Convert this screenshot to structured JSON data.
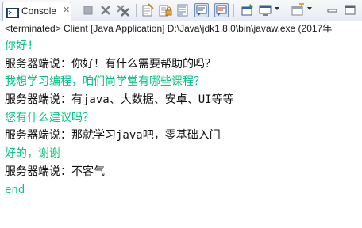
{
  "tab": {
    "label": "Console",
    "close": "✕"
  },
  "toolbar_icons": [
    "terminate-icon",
    "remove-launch-icon",
    "remove-all-icon",
    "clear-console-icon",
    "scroll-lock-icon",
    "word-wrap-icon",
    "show-on-stdout-icon",
    "show-on-stderr-icon",
    "pin-console-icon",
    "display-selected-console-icon",
    "open-console-icon"
  ],
  "status_line": "<terminated> Client [Java Application] D:\\Java\\jdk1.8.0\\bin\\javaw.exe (2017年",
  "console_lines": [
    {
      "type": "in",
      "text": "你好!"
    },
    {
      "type": "out",
      "text": "服务器端说：你好！有什么需要帮助的吗？"
    },
    {
      "type": "in",
      "text": "我想学习编程，咱们尚学堂有哪些课程？"
    },
    {
      "type": "out",
      "text": "服务器端说：有java、大数据、安卓、UI等等"
    },
    {
      "type": "in",
      "text": "您有什么建议吗？"
    },
    {
      "type": "out",
      "text": "服务器端说：那就学习java吧，零基础入门"
    },
    {
      "type": "in",
      "text": "好的，谢谢"
    },
    {
      "type": "out",
      "text": "服务器端说：不客气"
    },
    {
      "type": "in",
      "text": "end"
    }
  ],
  "colors": {
    "input_text": "#00c87d",
    "output_text": "#111111"
  }
}
